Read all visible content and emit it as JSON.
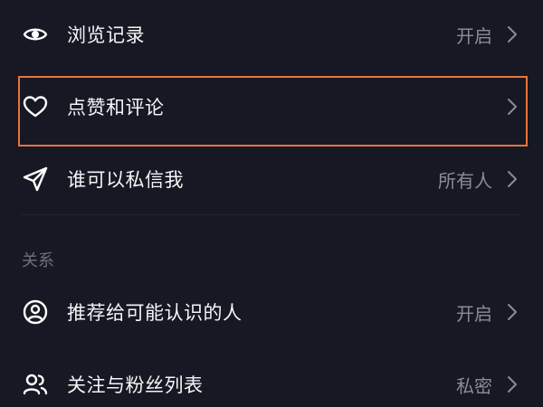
{
  "privacy": {
    "items": [
      {
        "label": "浏览记录",
        "value": "开启",
        "icon": "eye-icon"
      },
      {
        "label": "点赞和评论",
        "value": "",
        "icon": "heart-icon"
      },
      {
        "label": "谁可以私信我",
        "value": "所有人",
        "icon": "send-icon"
      }
    ]
  },
  "relations": {
    "header": "关系",
    "items": [
      {
        "label": "推荐给可能认识的人",
        "value": "开启",
        "icon": "user-circle-icon"
      },
      {
        "label": "关注与粉丝列表",
        "value": "私密",
        "icon": "users-icon"
      }
    ]
  },
  "colors": {
    "background": "#161823",
    "text": "#f5f5f7",
    "secondary_text": "#8b8c93",
    "highlight": "#e8743b"
  }
}
